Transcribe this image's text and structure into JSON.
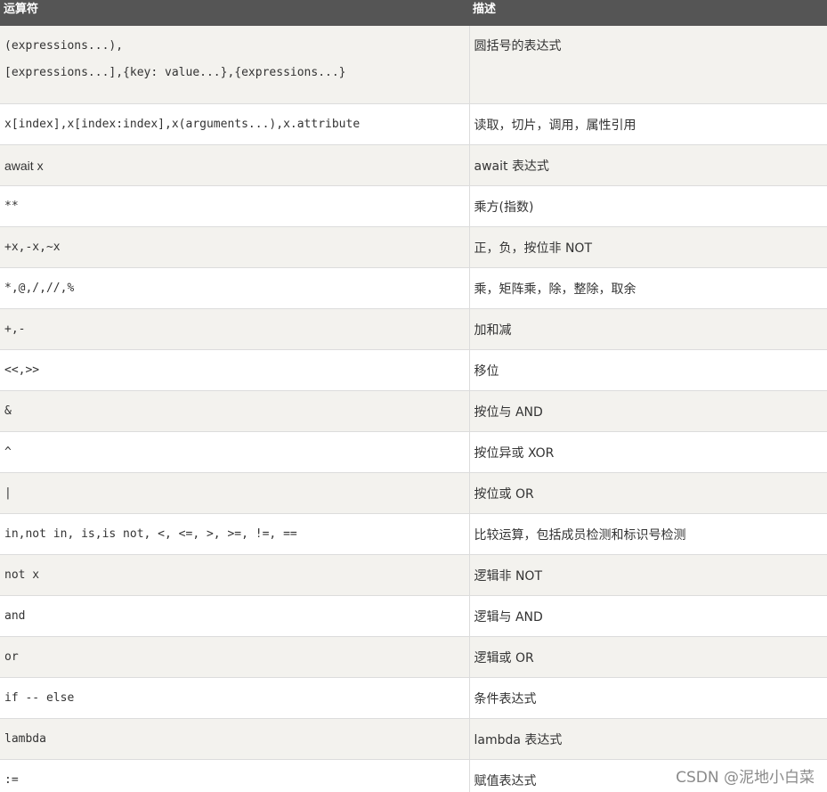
{
  "header": {
    "operator": "运算符",
    "description": "描述"
  },
  "rows": [
    {
      "op_line1": "(expressions...),",
      "op_line2": "[expressions...],{key: value...},{expressions...}",
      "desc": "圆括号的表达式"
    },
    {
      "op": "x[index],x[index:index],x(arguments...),x.attribute",
      "desc": "读取，切片，调用，属性引用"
    },
    {
      "op": "await x",
      "desc": "await 表达式"
    },
    {
      "op": "**",
      "desc": "乘方(指数)"
    },
    {
      "op": "+x,-x,~x",
      "desc": "正，负，按位非 NOT"
    },
    {
      "op": "*,@,/,//,%",
      "desc": "乘，矩阵乘，除，整除，取余"
    },
    {
      "op": "+,-",
      "desc": "加和减"
    },
    {
      "op": "<<,>>",
      "desc": "移位"
    },
    {
      "op": "&",
      "desc": "按位与 AND"
    },
    {
      "op": "^",
      "desc": "按位异或 XOR"
    },
    {
      "op": "|",
      "desc": "按位或 OR"
    },
    {
      "op": "in,not in, is,is not, <, <=, >, >=, !=, ==",
      "desc": "比较运算，包括成员检测和标识号检测"
    },
    {
      "op": "not x",
      "desc": "逻辑非 NOT"
    },
    {
      "op": "and",
      "desc": "逻辑与 AND"
    },
    {
      "op": "or",
      "desc": "逻辑或 OR"
    },
    {
      "op": "if -- else",
      "desc": "条件表达式"
    },
    {
      "op": "lambda",
      "desc": "lambda 表达式"
    },
    {
      "op": ":=",
      "desc": "赋值表达式"
    }
  ],
  "watermark": "CSDN @泥地小白菜"
}
